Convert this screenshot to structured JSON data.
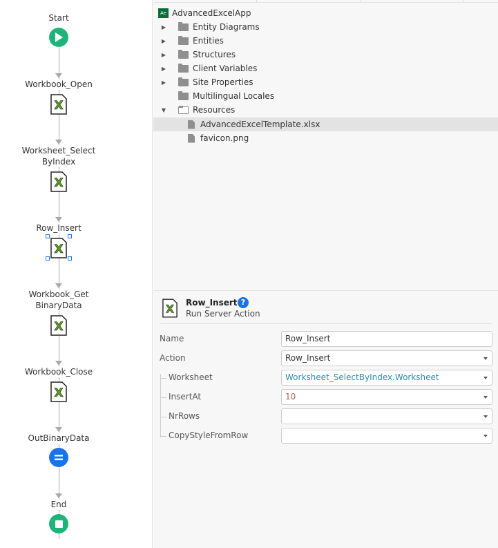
{
  "flow": {
    "nodes": [
      {
        "label": "Start",
        "type": "start"
      },
      {
        "label": "Workbook_Open",
        "type": "excel"
      },
      {
        "label": "Worksheet_Select ByIndex",
        "type": "excel"
      },
      {
        "label": "Row_Insert",
        "type": "excel",
        "selected": true
      },
      {
        "label": "Workbook_Get BinaryData",
        "type": "excel"
      },
      {
        "label": "Workbook_Close",
        "type": "excel"
      },
      {
        "label": "OutBinaryData",
        "type": "assign"
      },
      {
        "label": "End",
        "type": "end"
      }
    ],
    "labels": {
      "n0": "Start",
      "n1": "Workbook_Open",
      "n2a": "Worksheet_Select",
      "n2b": "ByIndex",
      "n3": "Row_Insert",
      "n4a": "Workbook_Get",
      "n4b": "BinaryData",
      "n5": "Workbook_Close",
      "n6": "OutBinaryData",
      "n7": "End"
    }
  },
  "tree": {
    "app_icon": "Ae",
    "app": "AdvancedExcelApp",
    "items": [
      "Entity Diagrams",
      "Entities",
      "Structures",
      "Client Variables",
      "Site Properties",
      "Multilingual Locales",
      "Resources"
    ],
    "files": [
      "AdvancedExcelTemplate.xlsx",
      "favicon.png"
    ]
  },
  "props": {
    "title": "Row_Insert",
    "help": "?",
    "subtitle": "Run Server Action",
    "rows": [
      {
        "label": "Name",
        "value": "Row_Insert"
      },
      {
        "label": "Action",
        "value": "Row_Insert"
      },
      {
        "label": "Worksheet",
        "value": "Worksheet_SelectByIndex.Worksheet"
      },
      {
        "label": "InsertAt",
        "value": "10"
      },
      {
        "label": "NrRows",
        "value": ""
      },
      {
        "label": "CopyStyleFromRow",
        "value": ""
      }
    ]
  },
  "colors": {
    "green": "#1fb57a",
    "blue": "#1a73e8",
    "excel": "#5a9e1a",
    "link": "#2a8ab3",
    "number": "#b5614a"
  }
}
